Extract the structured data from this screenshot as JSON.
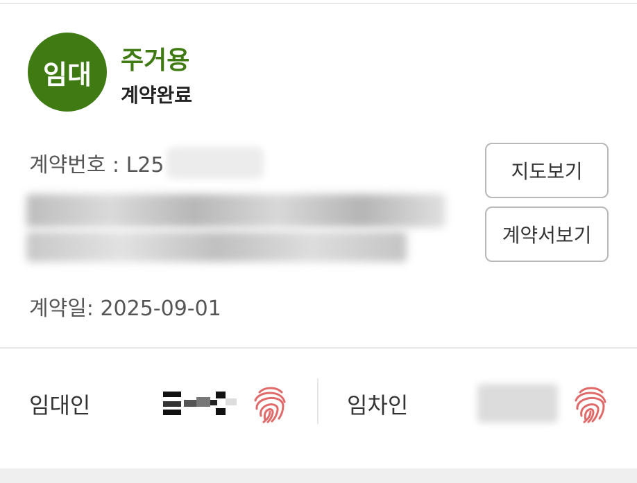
{
  "header": {
    "badge_label": "임대",
    "contract_type": "주거용",
    "contract_status": "계약완료"
  },
  "details": {
    "contract_no_label": "계약번호 : L25",
    "contract_date": "계약일: 2025-09-01"
  },
  "actions": {
    "map_label": "지도보기",
    "contract_view_label": "계약서보기"
  },
  "parties": {
    "landlord_label": "임대인",
    "tenant_label": "임차인"
  },
  "colors": {
    "accent": "#3f7a12",
    "fingerprint": "#e06a6a"
  },
  "icons": {
    "signature": "fingerprint-icon"
  }
}
